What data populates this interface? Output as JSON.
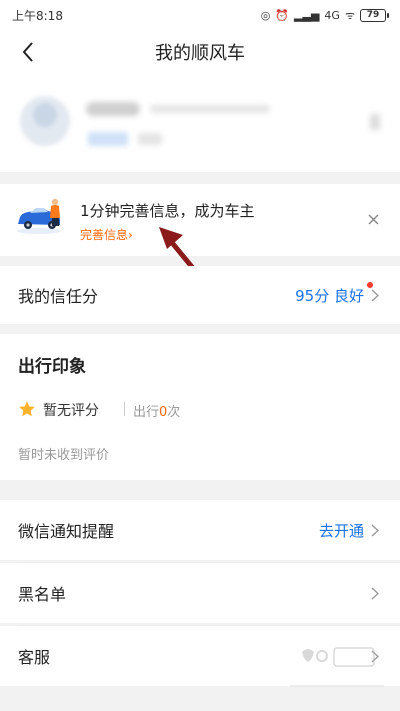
{
  "status_bar": {
    "time": "上午8:18",
    "network": "4G",
    "battery": "79"
  },
  "nav": {
    "title": "我的顺风车",
    "back_icon": "chevron-left-icon"
  },
  "promo": {
    "title": "1分钟完善信息，成为车主",
    "link": "完善信息›",
    "close_icon": "close-icon"
  },
  "trust": {
    "label": "我的信任分",
    "value": "95分 良好",
    "badge_color": "#ff3b30"
  },
  "impression": {
    "title": "出行印象",
    "rating": "暂无评分",
    "trips_prefix": "出行",
    "trips_count": "0",
    "trips_suffix": "次",
    "empty_text": "暂时未收到评价"
  },
  "wechat": {
    "label": "微信通知提醒",
    "value": "去开通"
  },
  "blacklist": {
    "label": "黑名单"
  },
  "service": {
    "label": "客服"
  },
  "colors": {
    "accent_blue": "#1a73e8",
    "accent_orange": "#ff6a10",
    "annotation_arrow": "#8b1a1a"
  }
}
